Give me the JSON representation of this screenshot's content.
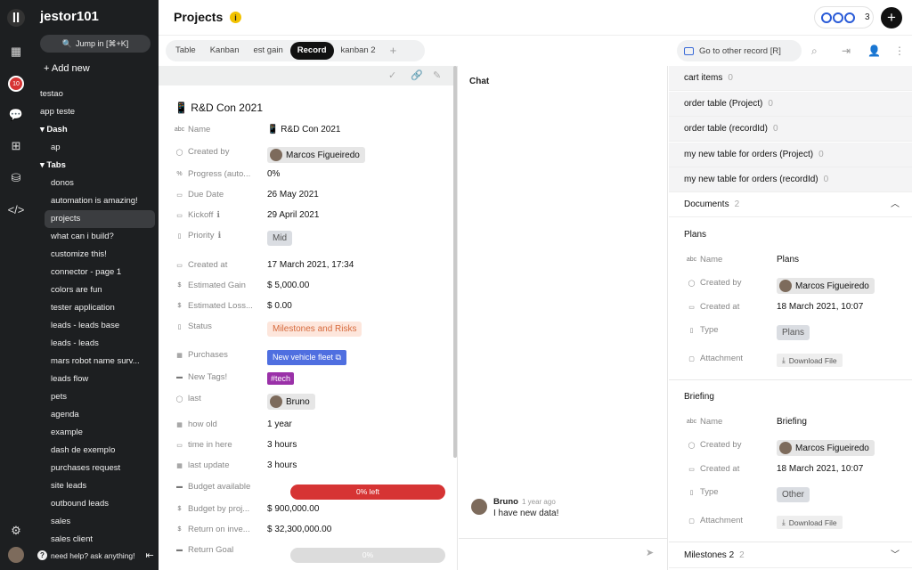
{
  "rail": {
    "notif_count": "10"
  },
  "workspace": {
    "name": "jestor101",
    "jump": "Jump in [⌘+K]",
    "add_new": "+ Add new",
    "help": "need help? ask anything!"
  },
  "nav": [
    {
      "label": "testao",
      "kind": "item"
    },
    {
      "label": "app teste",
      "kind": "item"
    },
    {
      "label": "Dash",
      "kind": "group"
    },
    {
      "label": "ap",
      "kind": "sub"
    },
    {
      "label": "Tabs",
      "kind": "group"
    },
    {
      "label": "donos",
      "kind": "sub"
    },
    {
      "label": "automation is amazing!",
      "kind": "sub"
    },
    {
      "label": "projects",
      "kind": "sub",
      "active": true
    },
    {
      "label": "what can i build?",
      "kind": "sub"
    },
    {
      "label": "customize this!",
      "kind": "sub"
    },
    {
      "label": "connector - page 1",
      "kind": "sub"
    },
    {
      "label": "colors are fun",
      "kind": "sub"
    },
    {
      "label": "tester application",
      "kind": "sub"
    },
    {
      "label": "leads - leads base",
      "kind": "sub"
    },
    {
      "label": "leads - leads",
      "kind": "sub"
    },
    {
      "label": "mars robot name surv...",
      "kind": "sub"
    },
    {
      "label": "leads flow",
      "kind": "sub"
    },
    {
      "label": "pets",
      "kind": "sub"
    },
    {
      "label": "agenda",
      "kind": "sub"
    },
    {
      "label": "example",
      "kind": "sub"
    },
    {
      "label": "dash de exemplo",
      "kind": "sub"
    },
    {
      "label": "purchases request",
      "kind": "sub"
    },
    {
      "label": "site leads",
      "kind": "sub"
    },
    {
      "label": "outbound leads",
      "kind": "sub"
    },
    {
      "label": "sales",
      "kind": "sub"
    },
    {
      "label": "sales client",
      "kind": "sub"
    }
  ],
  "header": {
    "title": "Projects",
    "presence_count": "3"
  },
  "tabs": [
    "Table",
    "Kanban",
    "est gain",
    "Record",
    "kanban 2"
  ],
  "active_tab": "Record",
  "goto": "Go to other record [R]",
  "record": {
    "title": "📱 R&D Con 2021",
    "fields": [
      {
        "icon": "abc",
        "label": "Name",
        "value": "📱 R&D Con 2021",
        "kind": "text"
      },
      {
        "icon": "user",
        "label": "Created by",
        "value": "Marcos Figueiredo",
        "kind": "person"
      },
      {
        "icon": "%",
        "label": "Progress (auto...",
        "value": "0%",
        "kind": "text"
      },
      {
        "icon": "cal",
        "label": "Due Date",
        "value": "26 May 2021",
        "kind": "text"
      },
      {
        "icon": "cal",
        "label": "Kickoff",
        "value": "29 April 2021",
        "kind": "text",
        "info": true
      },
      {
        "icon": "doc",
        "label": "Priority",
        "value": "Mid",
        "kind": "mid",
        "info": true
      },
      {
        "icon": "cal",
        "label": "Created at",
        "value": "17 March 2021, 17:34",
        "kind": "text"
      },
      {
        "icon": "$",
        "label": "Estimated Gain",
        "value": "$ 5,000.00",
        "kind": "text"
      },
      {
        "icon": "$",
        "label": "Estimated Loss...",
        "value": "$ 0.00",
        "kind": "text"
      },
      {
        "icon": "doc",
        "label": "Status",
        "value": "Milestones and Risks",
        "kind": "ms"
      },
      {
        "icon": "grid",
        "label": "Purchases",
        "value": "New vehicle fleet",
        "kind": "veh"
      },
      {
        "icon": "tag",
        "label": "New Tags!",
        "value": "#tech",
        "kind": "tag"
      },
      {
        "icon": "user",
        "label": "last",
        "value": "Bruno",
        "kind": "person"
      },
      {
        "icon": "grid",
        "label": "how old",
        "value": "1 year",
        "kind": "text"
      },
      {
        "icon": "cal",
        "label": "time in here",
        "value": "3 hours",
        "kind": "text"
      },
      {
        "icon": "grid",
        "label": "last update",
        "value": "3 hours",
        "kind": "text"
      },
      {
        "icon": "bar",
        "label": "Budget available",
        "value": "0% left",
        "kind": "bar",
        "fraction": 0
      },
      {
        "icon": "$",
        "label": "Budget by proj...",
        "value": "$ 900,000.00",
        "kind": "text"
      },
      {
        "icon": "$",
        "label": "Return on inve...",
        "value": "$ 32,300,000.00",
        "kind": "text"
      },
      {
        "icon": "bar",
        "label": "Return Goal",
        "value": "0%",
        "kind": "bargray",
        "fraction": 0
      }
    ]
  },
  "chat": {
    "title": "Chat",
    "author": "Bruno",
    "time": "1 year ago",
    "text": "I have new data!"
  },
  "related": {
    "rows": [
      {
        "label": "cart items",
        "count": "0"
      },
      {
        "label": "order table (Project)",
        "count": "0"
      },
      {
        "label": "order table (recordId)",
        "count": "0"
      },
      {
        "label": "my new table for orders (Project)",
        "count": "0"
      },
      {
        "label": "my new table for orders (recordId)",
        "count": "0"
      }
    ],
    "documents": {
      "label": "Documents",
      "count": "2"
    },
    "docs": [
      {
        "title": "Plans",
        "name": "Plans",
        "created_by": "Marcos Figueiredo",
        "created_at": "18 March 2021, 10:07",
        "type": "Plans"
      },
      {
        "title": "Briefing",
        "name": "Briefing",
        "created_by": "Marcos Figueiredo",
        "created_at": "18 March 2021, 10:07",
        "type": "Other"
      }
    ],
    "doc_labels": {
      "name": "Name",
      "created_by": "Created by",
      "created_at": "Created at",
      "type": "Type",
      "attachment": "Attachment",
      "download": "Download File"
    },
    "milestones": {
      "label": "Milestones 2",
      "count": "2"
    }
  }
}
